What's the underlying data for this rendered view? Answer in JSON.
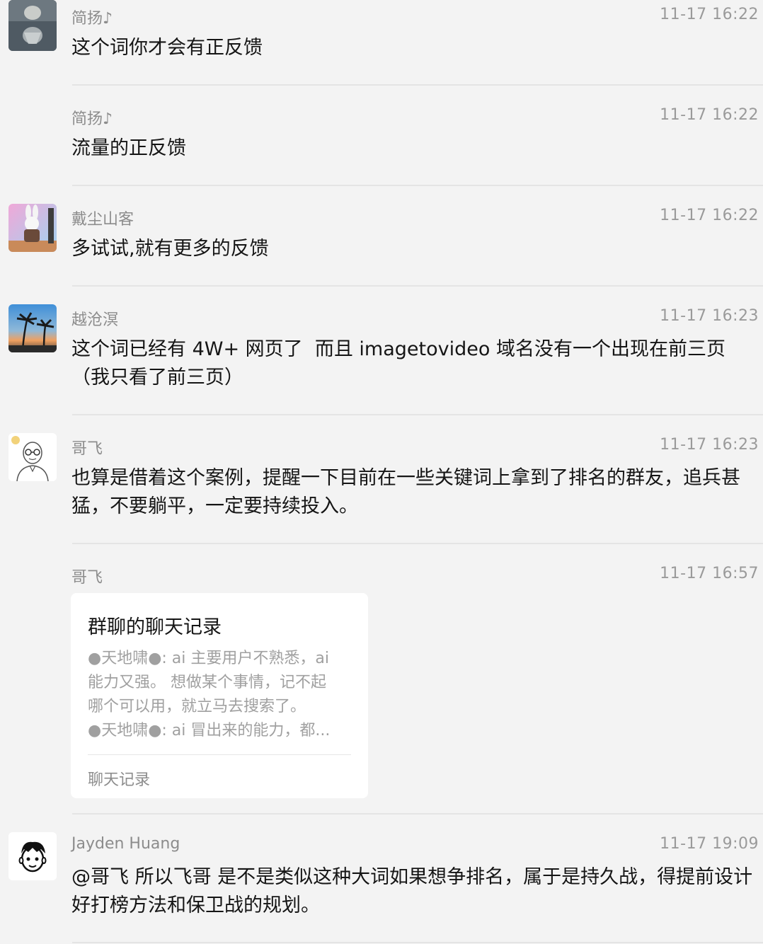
{
  "messages": [
    {
      "sender": "简扬♪",
      "time": "11-17 16:22",
      "text": "这个词你才会有正反馈",
      "avatar": "tiger-reflection-avatar"
    },
    {
      "sender": "简扬♪",
      "time": "11-17 16:22",
      "text": "流量的正反馈"
    },
    {
      "sender": "戴尘山客",
      "time": "11-17 16:22",
      "text": "多试试,就有更多的反馈",
      "avatar": "rabbit-avatar"
    },
    {
      "sender": "越沧溟",
      "time": "11-17 16:23",
      "text": "这个词已经有 4W+ 网页了  而且 imagetovideo 域名没有一个出现在前三页（我只看了前三页）",
      "avatar": "palm-beach-avatar"
    },
    {
      "sender": "哥飞",
      "time": "11-17 16:23",
      "text": "也算是借着这个案例，提醒一下目前在一些关键词上拿到了排名的群友，追兵甚猛，不要躺平，一定要持续投入。",
      "avatar": "bald-glasses-avatar"
    },
    {
      "sender": "哥飞",
      "time": "11-17 16:57",
      "card": {
        "title": "群聊的聊天记录",
        "preview": [
          "●天地啸●: ai 主要用户不熟悉，ai",
          "能力又强。 想做某个事情，记不起",
          "哪个可以用，就立马去搜索了。",
          "●天地啸●: ai 冒出来的能力，都..."
        ],
        "footer": "聊天记录"
      }
    },
    {
      "sender": "Jayden Huang",
      "time": "11-17 19:09",
      "text": "@哥飞 所以飞哥 是不是类似这种大词如果想争排名，属于是持久战，得提前设计好打榜方法和保卫战的规划。",
      "avatar": "cartoon-face-avatar"
    }
  ]
}
